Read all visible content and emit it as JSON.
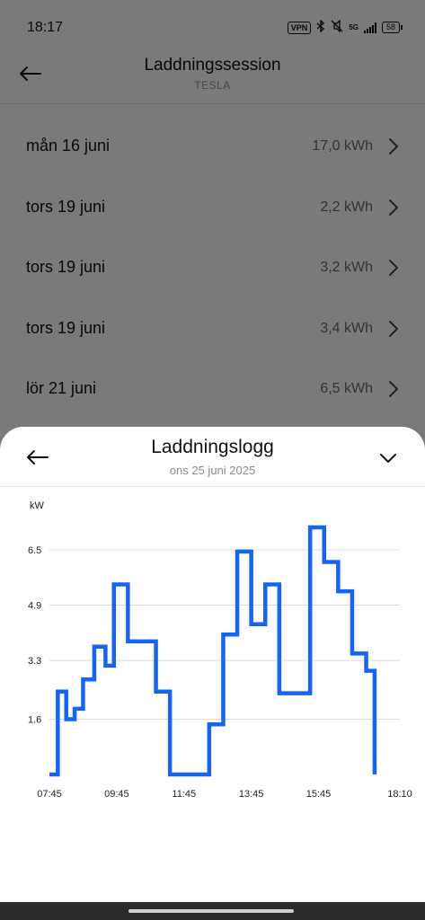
{
  "status": {
    "time": "18:17",
    "vpn": "VPN",
    "network": "5G",
    "battery": "58"
  },
  "header": {
    "title": "Laddningssession",
    "subtitle": "TESLA"
  },
  "sessions": [
    {
      "date": "mån 16 juni",
      "energy": "17,0 kWh"
    },
    {
      "date": "tors 19 juni",
      "energy": "2,2 kWh"
    },
    {
      "date": "tors 19 juni",
      "energy": "3,2 kWh"
    },
    {
      "date": "tors 19 juni",
      "energy": "3,4 kWh"
    },
    {
      "date": "lör 21 juni",
      "energy": "6,5 kWh"
    }
  ],
  "sheet": {
    "title": "Laddningslogg",
    "date": "ons 25 juni 2025"
  },
  "colors": {
    "accent": "#1565f0",
    "scrim": "rgba(0,0,0,0.5)"
  },
  "icons": {
    "back": "arrow-left-icon",
    "row": "chevron-right-icon",
    "close": "chevron-down-icon"
  },
  "chart_data": {
    "type": "line",
    "step": true,
    "ylabel": "kW",
    "ylim": [
      0,
      7.8
    ],
    "yticks": [
      "1.6",
      "3.3",
      "4.9",
      "6.5"
    ],
    "ytick_values": [
      1.6,
      3.3,
      4.9,
      6.5
    ],
    "xticks": [
      "07:45",
      "09:45",
      "11:45",
      "13:45",
      "15:45",
      "18:10"
    ],
    "xtick_values": [
      "07:45",
      "09:45",
      "11:45",
      "13:45",
      "15:45",
      "18:10"
    ],
    "grid": true,
    "series": [
      {
        "color": "#1565f0",
        "points": [
          [
            "07:45",
            0.0
          ],
          [
            "08:00",
            2.4
          ],
          [
            "08:15",
            1.6
          ],
          [
            "08:30",
            1.9
          ],
          [
            "08:45",
            2.75
          ],
          [
            "09:05",
            3.7
          ],
          [
            "09:25",
            3.15
          ],
          [
            "09:40",
            5.5
          ],
          [
            "10:05",
            3.85
          ],
          [
            "10:55",
            2.4
          ],
          [
            "11:20",
            0.0
          ],
          [
            "12:30",
            1.45
          ],
          [
            "12:55",
            4.05
          ],
          [
            "13:20",
            6.45
          ],
          [
            "13:45",
            4.35
          ],
          [
            "14:10",
            5.5
          ],
          [
            "14:35",
            2.35
          ],
          [
            "15:30",
            7.15
          ],
          [
            "15:55",
            6.15
          ],
          [
            "16:20",
            5.3
          ],
          [
            "16:45",
            3.5
          ],
          [
            "17:10",
            3.0
          ],
          [
            "17:25",
            0.0
          ]
        ]
      }
    ]
  }
}
